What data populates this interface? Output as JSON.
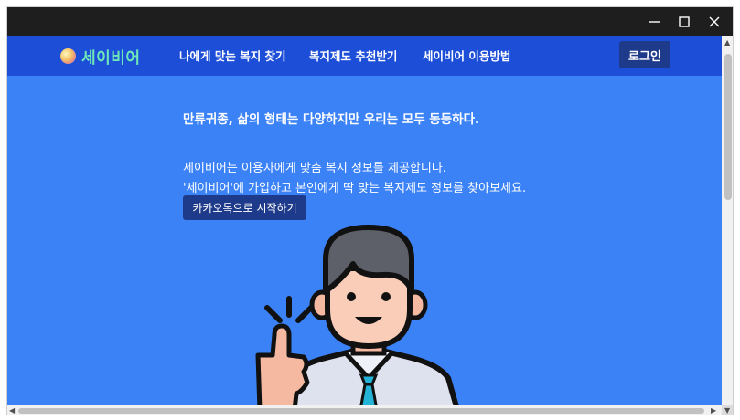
{
  "window": {
    "controls": {
      "minimize_icon": "minimize-icon",
      "maximize_icon": "maximize-icon",
      "close_icon": "close-icon"
    }
  },
  "navbar": {
    "logo_text": "세이비어",
    "links": [
      "나에게 맞는 복지 찾기",
      "복지제도 추천받기",
      "세이비어 이용방법"
    ],
    "login_label": "로그인"
  },
  "hero": {
    "headline": "만류귀종, 삶의 형태는 다양하지만 우리는 모두 동등하다.",
    "description_line1": "세이비어는 이용자에게 맞춤 복지 정보를 제공합니다.",
    "description_line2": "'세이비어'에 가입하고 본인에게 딱 맞는 복지제도 정보를 찾아보세요.",
    "cta_label": "카카오톡으로 시작하기"
  },
  "colors": {
    "page_background": "#3b82f6",
    "navbar_background": "#1d4ed8",
    "button_background": "#1e3a8a",
    "logo_text": "#6ee7b7",
    "titlebar": "#1e1e1e"
  }
}
